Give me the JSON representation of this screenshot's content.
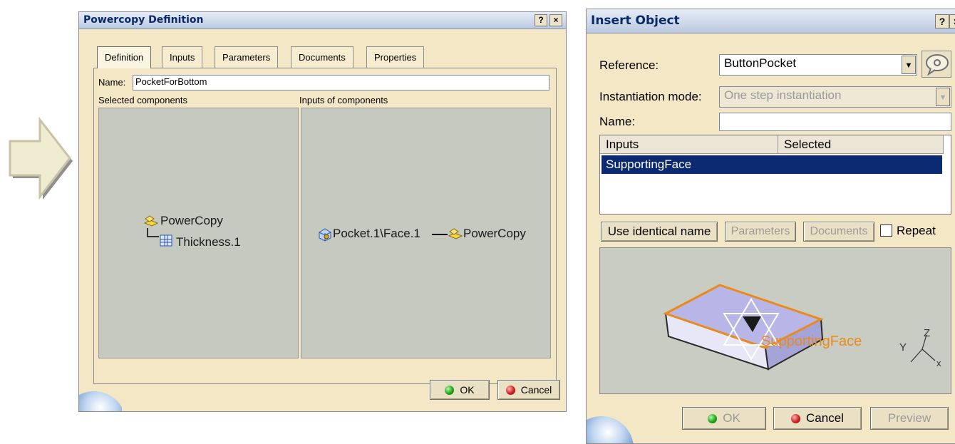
{
  "powercopy": {
    "title": "Powercopy Definition",
    "help_label": "?",
    "close_label": "×",
    "tabs": [
      "Definition",
      "Inputs",
      "Parameters",
      "Documents",
      "Properties"
    ],
    "name_label": "Name:",
    "name_value": "PocketForBottom",
    "selected_components_label": "Selected components",
    "inputs_of_components_label": "Inputs of components",
    "tree_root": "PowerCopy",
    "tree_child": "Thickness.1",
    "input_source": "Pocket.1\\Face.1",
    "input_target": "PowerCopy",
    "ok_label": "OK",
    "cancel_label": "Cancel"
  },
  "insert_object": {
    "title": "Insert Object",
    "help_label": "?",
    "close_label": "×",
    "reference_label": "Reference:",
    "reference_value": "ButtonPocket",
    "mode_label": "Instantiation mode:",
    "mode_value": "One step instantiation",
    "name_label": "Name:",
    "name_value": "",
    "table_headers": [
      "Inputs",
      "Selected"
    ],
    "table_rows": [
      {
        "input": "SupportingFace",
        "selected": ""
      }
    ],
    "use_identical_name_label": "Use identical name",
    "parameters_label": "Parameters",
    "documents_label": "Documents",
    "repeat_label": "Repeat",
    "viewer_face_label": "SupportingFace",
    "axis_y": "Y",
    "axis_z": "Z",
    "axis_x": "x",
    "ok_label": "OK",
    "cancel_label": "Cancel",
    "preview_label": "Preview"
  },
  "icons": [
    "arrow-right-icon",
    "powercopy-icon",
    "thickness-icon",
    "pocket-face-icon",
    "speech-bubble-icon",
    "ok-dot-icon",
    "cancel-dot-icon",
    "globe-logo-icon",
    "compass-axis-icon"
  ]
}
